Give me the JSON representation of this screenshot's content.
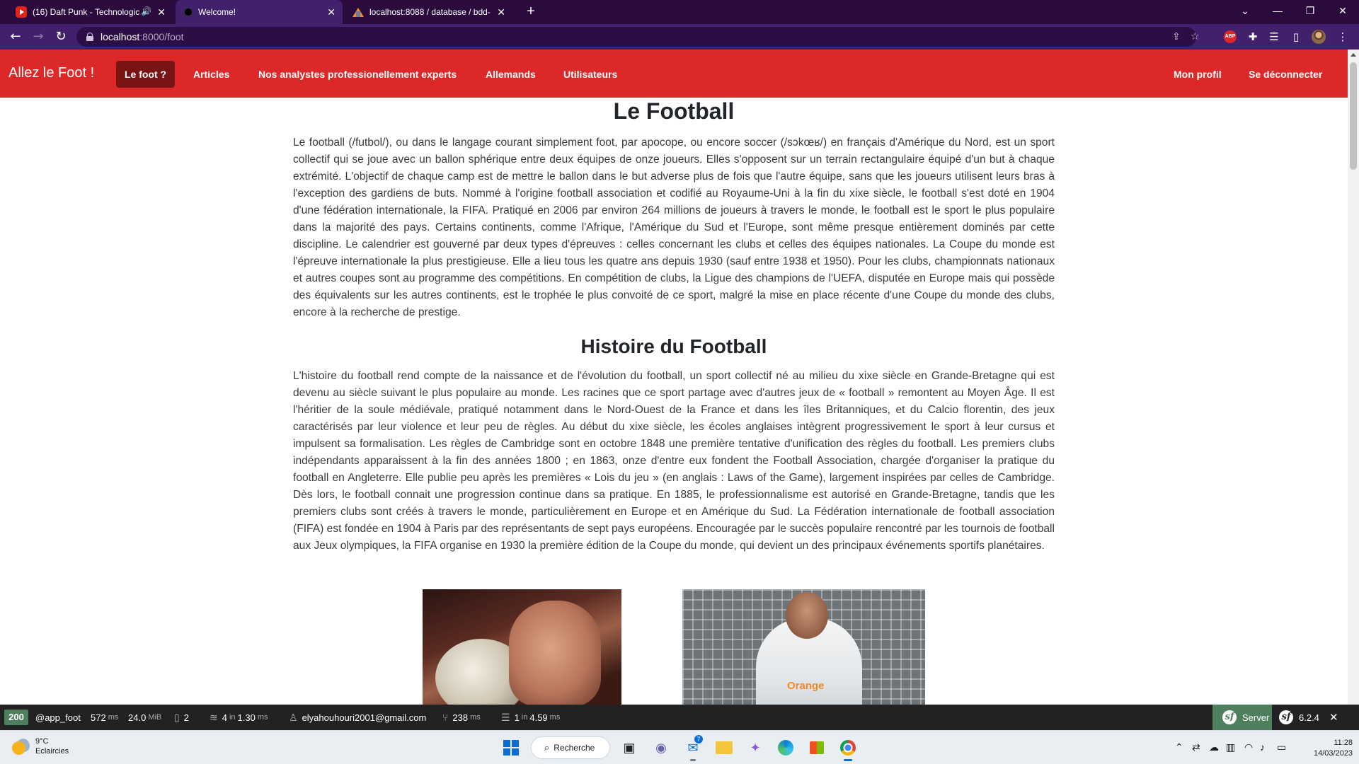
{
  "browser": {
    "tabs": [
      {
        "title": "(16) Daft Punk - Technologic",
        "favicon": "youtube-icon",
        "active": false
      },
      {
        "title": "Welcome!",
        "favicon": "dot-icon",
        "active": true
      },
      {
        "title": "localhost:8088 / database / bdd-",
        "favicon": "phpmyadmin-icon",
        "active": false
      }
    ],
    "new_tab": "+",
    "window_controls": {
      "tab_search": "⌄",
      "minimize": "—",
      "restore": "❐",
      "close": "✕"
    },
    "address": {
      "host": "localhost",
      "path": ":8000/foot"
    }
  },
  "site": {
    "brand": "Allez le Foot !",
    "nav": [
      {
        "label": "Le foot ?",
        "active": true
      },
      {
        "label": "Articles",
        "active": false
      },
      {
        "label": "Nos analystes professionellement experts",
        "active": false
      },
      {
        "label": "Allemands",
        "active": false
      },
      {
        "label": "Utilisateurs",
        "active": false
      }
    ],
    "nav_right": [
      {
        "label": "Mon profil"
      },
      {
        "label": "Se déconnecter"
      }
    ]
  },
  "article": {
    "title": "Le Football",
    "intro": "Le football (/futbol/), ou dans le langage courant simplement foot, par apocope, ou encore soccer (/sɔkœʁ/) en français d'Amérique du Nord, est un sport collectif qui se joue avec un ballon sphérique entre deux équipes de onze joueurs. Elles s'opposent sur un terrain rectangulaire équipé d'un but à chaque extrémité. L'objectif de chaque camp est de mettre le ballon dans le but adverse plus de fois que l'autre équipe, sans que les joueurs utilisent leurs bras à l'exception des gardiens de buts. Nommé à l'origine football association et codifié au Royaume-Uni à la fin du xixe siècle, le football s'est doté en 1904 d'une fédération internationale, la FIFA. Pratiqué en 2006 par environ 264 millions de joueurs à travers le monde, le football est le sport le plus populaire dans la majorité des pays. Certains continents, comme l'Afrique, l'Amérique du Sud et l'Europe, sont même presque entièrement dominés par cette discipline. Le calendrier est gouverné par deux types d'épreuves : celles concernant les clubs et celles des équipes nationales. La Coupe du monde est l'épreuve internationale la plus prestigieuse. Elle a lieu tous les quatre ans depuis 1930 (sauf entre 1938 et 1950). Pour les clubs, championnats nationaux et autres coupes sont au programme des compétitions. En compétition de clubs, la Ligue des champions de l'UEFA, disputée en Europe mais qui possède des équivalents sur les autres continents, est le trophée le plus convoité de ce sport, malgré la mise en place récente d'une Coupe du monde des clubs, encore à la recherche de prestige.",
    "history_title": "Histoire du Football",
    "history": "L'histoire du football rend compte de la naissance et de l'évolution du football, un sport collectif né au milieu du xixe siècle en Grande-Bretagne qui est devenu au siècle suivant le plus populaire au monde. Les racines que ce sport partage avec d'autres jeux de « football » remontent au Moyen Âge. Il est l'héritier de la soule médiévale, pratiqué notamment dans le Nord-Ouest de la France et dans les îles Britanniques, et du Calcio florentin, des jeux caractérisés par leur violence et leur peu de règles. Au début du xixe siècle, les écoles anglaises intègrent progressivement le sport à leur cursus et impulsent sa formalisation. Les règles de Cambridge sont en octobre 1848 une première tentative d'unification des règles du football. Les premiers clubs indépendants apparaissent à la fin des années 1800 ; en 1863, onze d'entre eux fondent the Football Association, chargée d'organiser la pratique du football en Angleterre. Elle publie peu après les premières « Lois du jeu » (en anglais : Laws of the Game), largement inspirées par celles de Cambridge. Dès lors, le football connait une progression continue dans sa pratique. En 1885, le professionnalisme est autorisé en Grande-Bretagne, tandis que les premiers clubs sont créés à travers le monde, particulièrement en Europe et en Amérique du Sud. La Fédération internationale de football association (FIFA) est fondée en 1904 à Paris par des représentants de sept pays européens. Encouragée par le succès populaire rencontré par les tournois de football aux Jeux olympiques, la FIFA organise en 1930 la première édition de la Coupe du monde, qui devient un des principaux événements sportifs planétaires.",
    "photo_sponsor_text": "Orange"
  },
  "debug_toolbar": {
    "status_code": "200",
    "route": "@app_foot",
    "time_value": "572",
    "time_unit": "ms",
    "memory_value": "24.0",
    "memory_unit": "MiB",
    "logs_count": "2",
    "templates": "4",
    "templates_in": "in",
    "templates_time": "1.30",
    "templates_unit": "ms",
    "user": "elyahouhouri2001@gmail.com",
    "events_value": "238",
    "events_unit": "ms",
    "db_queries": "1",
    "db_in": "in",
    "db_time": "4.59",
    "db_unit": "ms",
    "server_label": "Server",
    "symfony_version": "6.2.4",
    "close": "✕",
    "status_color": "#4f805d"
  },
  "taskbar": {
    "weather_temp": "9°C",
    "weather_desc": "Eclaircies",
    "search_label": "Recherche",
    "mail_badge": "7",
    "time": "11:28",
    "date": "14/03/2023"
  }
}
